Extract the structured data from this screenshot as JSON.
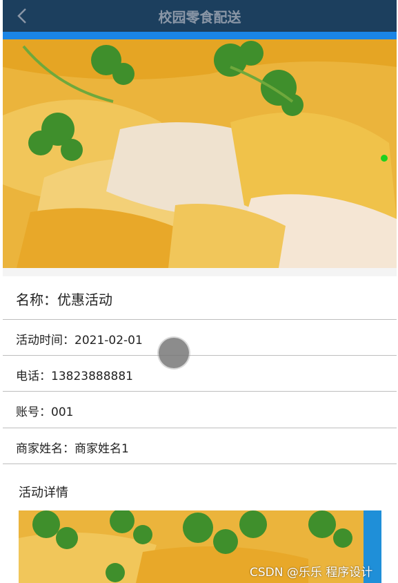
{
  "header": {
    "title": "校园零食配送",
    "back_icon": "chevron-left-icon"
  },
  "hero_image": {
    "alt": "白切鸡",
    "active_indicator_color": "#1ed11e"
  },
  "info": {
    "name": "名称：优惠活动",
    "time": "活动时间：2021-02-01",
    "phone": "电话：13823888881",
    "account": "账号：001",
    "merchant": "商家姓名：商家姓名1"
  },
  "detail": {
    "label": "活动详情"
  },
  "watermark": "CSDN @乐乐 程序设计",
  "colors": {
    "topbar": "#1c3f5e",
    "accent": "#1a85e6"
  }
}
